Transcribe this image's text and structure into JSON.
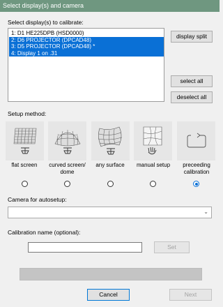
{
  "window": {
    "title": "Select display(s) and camera"
  },
  "displays": {
    "label": "Select display(s) to calibrate:",
    "items": [
      {
        "text": "1: D1 HE225DPB (HSD0000)",
        "selected": false
      },
      {
        "text": "2: D6 PROJECTOR (DPCAD48)",
        "selected": true
      },
      {
        "text": "3: D5 PROJECTOR (DPCAD48) *",
        "selected": true
      },
      {
        "text": "4: Display 1 on .31",
        "selected": true
      }
    ],
    "display_split": "display split",
    "select_all": "select all",
    "deselect_all": "deselect all"
  },
  "setup": {
    "label": "Setup method:",
    "methods": [
      {
        "label": "flat screen",
        "icon": "flat-screen-grid-icon"
      },
      {
        "label": "curved screen/ dome",
        "icon": "dome-grid-icon"
      },
      {
        "label": "any surface",
        "icon": "any-surface-grid-icon"
      },
      {
        "label": "manual setup",
        "icon": "manual-setup-hand-icon"
      },
      {
        "label": "preceeding calibration",
        "icon": "preceeding-calibration-arrow-icon"
      }
    ],
    "selected_index": 4
  },
  "camera": {
    "label": "Camera for autosetup:",
    "value": ""
  },
  "calibration_name": {
    "label": "Calibration name (optional):",
    "value": "",
    "set_label": "Set"
  },
  "progress": {
    "value": 0
  },
  "footer": {
    "cancel": "Cancel",
    "next": "Next"
  }
}
